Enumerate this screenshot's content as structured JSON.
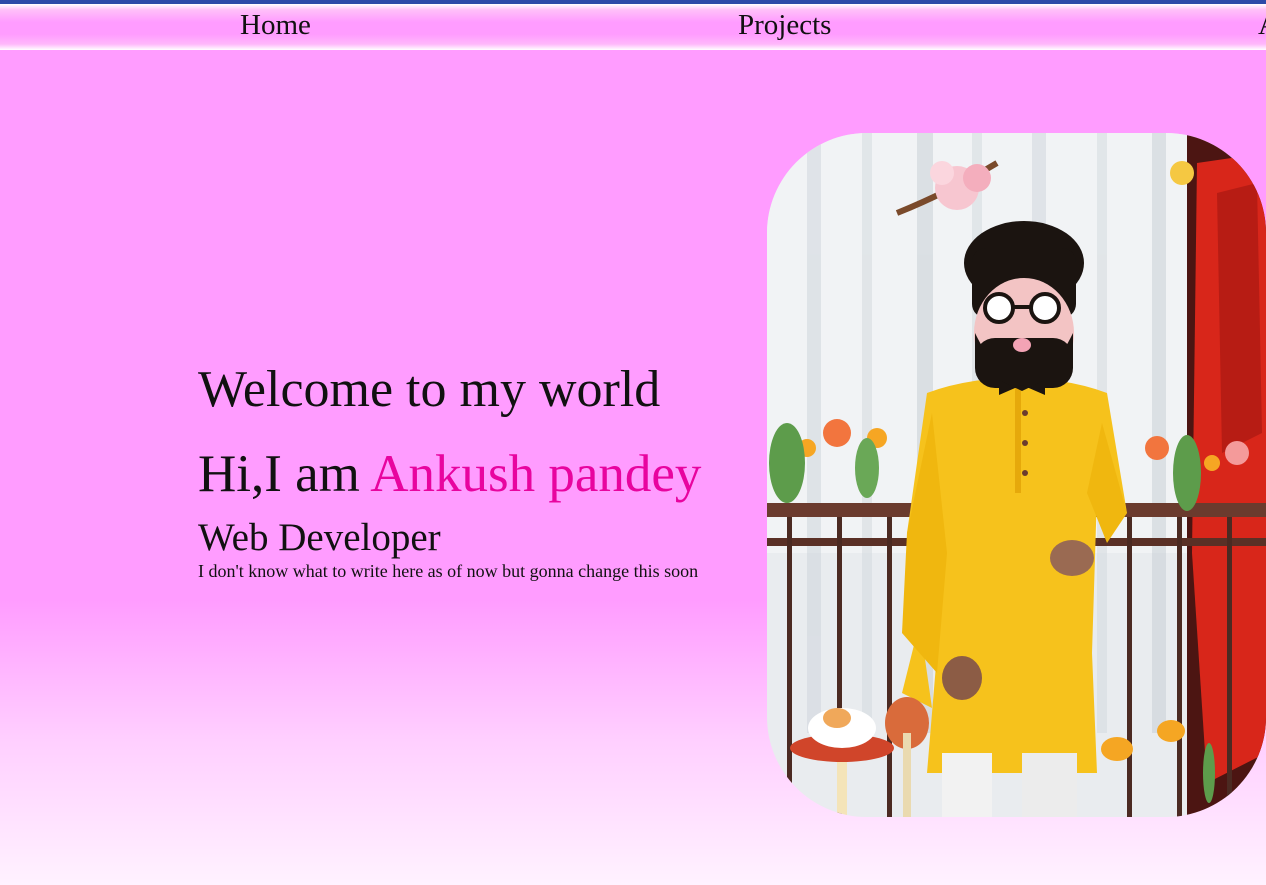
{
  "nav": {
    "items": [
      {
        "label": "Home"
      },
      {
        "label": "Projects"
      },
      {
        "label": "A"
      }
    ]
  },
  "hero": {
    "welcome": "Welcome to my world",
    "greeting": "Hi,I am ",
    "name": "Ankush pandey",
    "role": "Web Developer",
    "tagline": "I don't know what to write here as of now but gonna change this soon"
  },
  "colors": {
    "background": "#ff9cff",
    "name_accent": "#e8049f",
    "top_border": "#2d4aa8"
  }
}
